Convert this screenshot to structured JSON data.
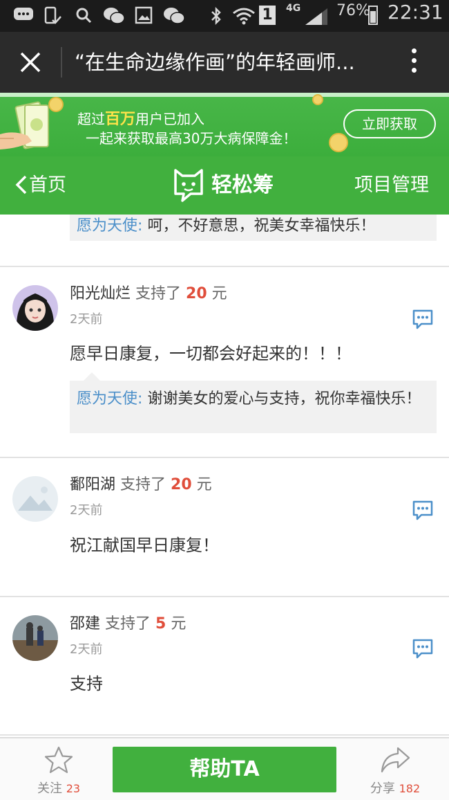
{
  "status_bar": {
    "sim_indicator": "1",
    "network": "4G",
    "battery": "76%",
    "time": "22:31"
  },
  "title_bar": {
    "title": "“在生命边缘作画”的年轻画师..."
  },
  "banner": {
    "line1_prefix": "超过",
    "line1_highlight": "百万",
    "line1_suffix": "用户已加入",
    "line2": "一起来获取最高30万大病保障金！",
    "cta": "立即获取"
  },
  "nav": {
    "back_label": "首页",
    "brand": "轻松筹",
    "manage_label": "项目管理"
  },
  "support_word": "支持了",
  "currency_word": "元",
  "top_reply": {
    "author": "愿为天使",
    "text": "呵，不好意思，祝美女幸福快乐！"
  },
  "comments": [
    {
      "name": "阳光灿烂",
      "amount": "20",
      "time": "2天前",
      "message": "愿早日康复，一切都会好起来的！！！",
      "reply_author": "愿为天使",
      "reply_text": "谢谢美女的爱心与支持，祝你幸福快乐！"
    },
    {
      "name": "鄱阳湖",
      "amount": "20",
      "time": "2天前",
      "message": "祝江献国早日康复！"
    },
    {
      "name": "邵建",
      "amount": "5",
      "time": "2天前",
      "message": "支持"
    }
  ],
  "bottom_bar": {
    "follow_label": "关注",
    "follow_count": "23",
    "help_button": "帮助TA",
    "share_label": "分享",
    "share_count": "182"
  },
  "colors": {
    "brand_green": "#41b03e",
    "amount_red": "#e04e3b",
    "reply_author_blue": "#4b8fc9"
  }
}
